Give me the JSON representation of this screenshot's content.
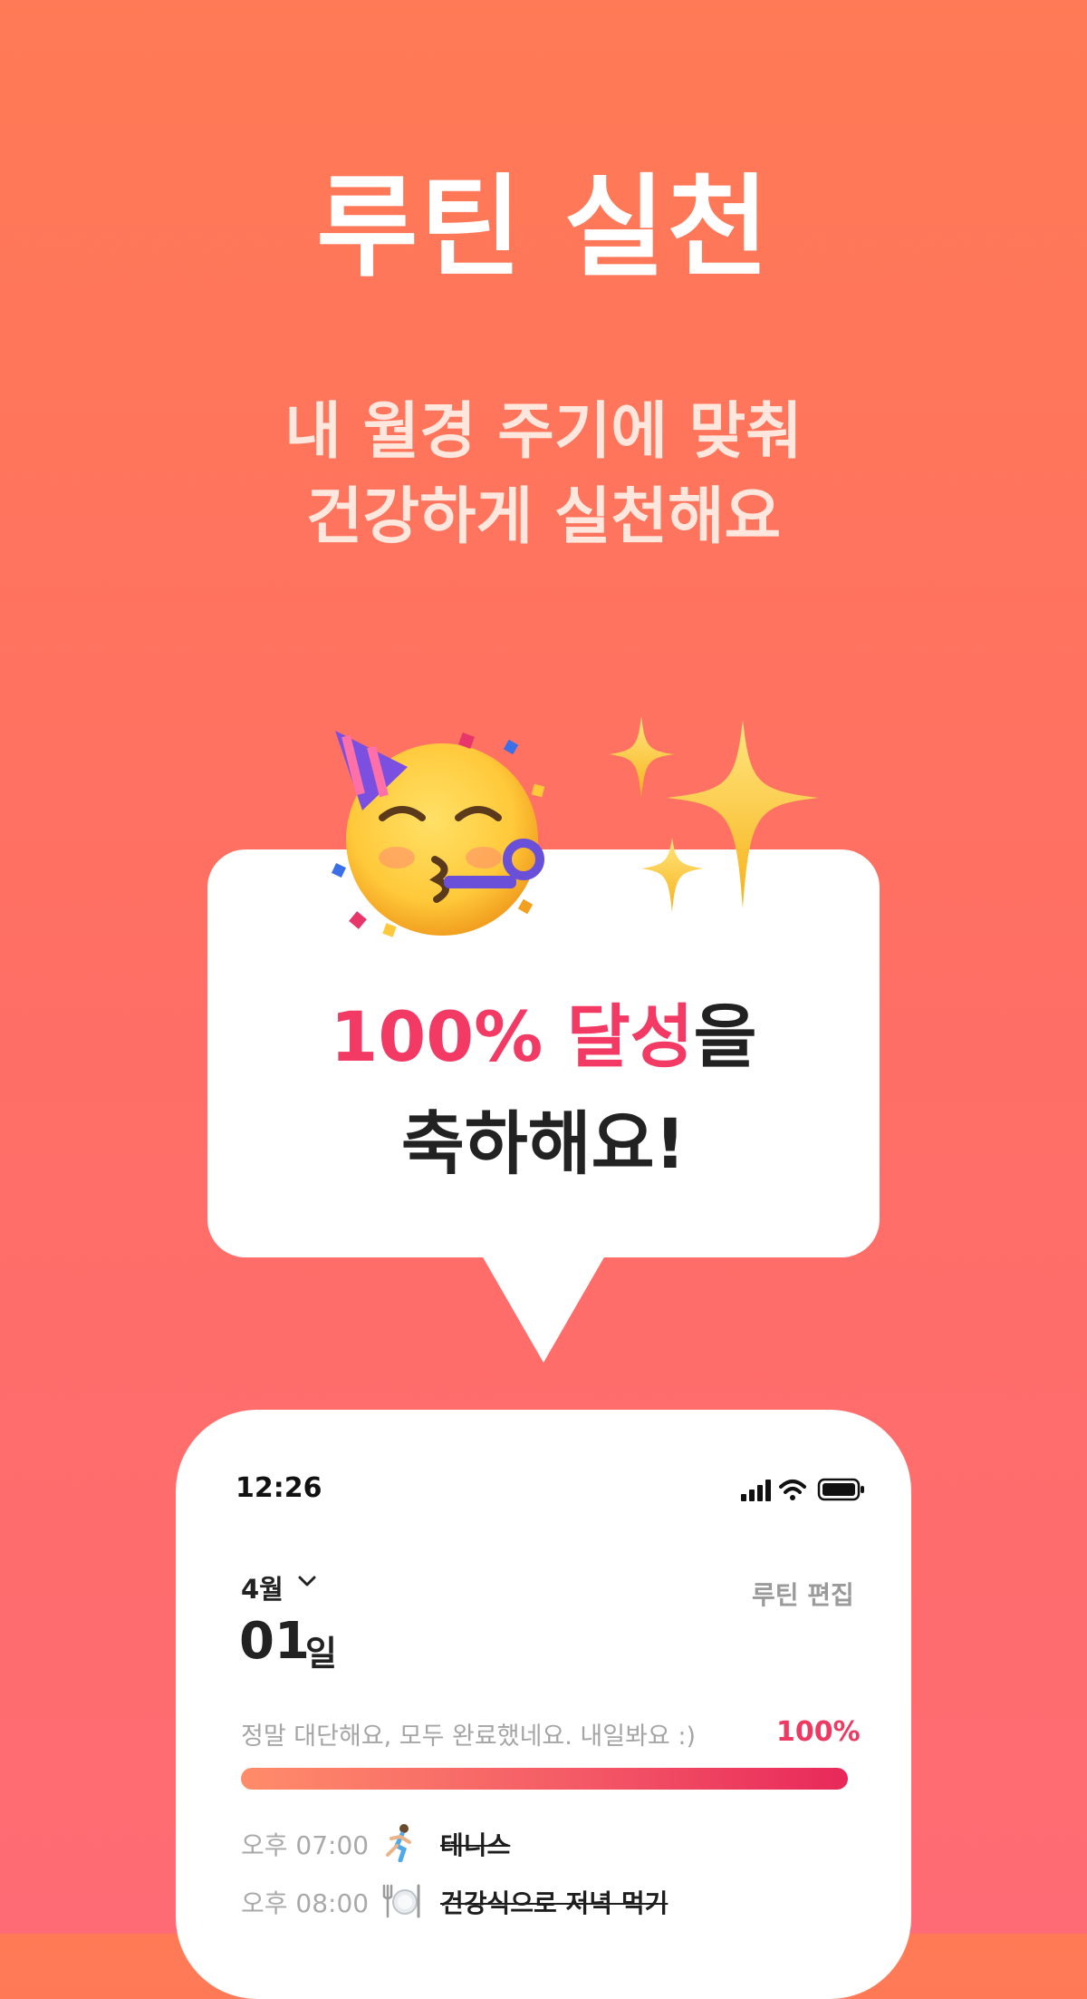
{
  "hero": {
    "title": "루틴 실천",
    "subtitle_line1": "내 월경 주기에 맞춰",
    "subtitle_line2": "건강하게 실천해요"
  },
  "celebration": {
    "highlight": "100% 달성",
    "suffix": "을",
    "line2": "축하해요!",
    "highlight_color": "#F23A64",
    "icons": [
      "partying-face-icon",
      "sparkles-icon"
    ]
  },
  "phone": {
    "status": {
      "time": "12:26",
      "icons": [
        "signal-icon",
        "wifi-icon",
        "battery-icon"
      ]
    },
    "header": {
      "month": "4월",
      "day": "01",
      "day_unit": "일",
      "edit_label": "루틴 편집"
    },
    "progress": {
      "message": "정말 대단해요, 모두 완료했네요. 내일봐요 :)",
      "percent_label": "100%",
      "value": 1.0
    },
    "routines": [
      {
        "time": "오후  07:00",
        "icon": "runner-icon",
        "name": "테니스",
        "done": true
      },
      {
        "time": "오후  08:00",
        "icon": "plate-icon",
        "name": "건강식으로 저녁 먹기",
        "done": true
      }
    ]
  },
  "colors": {
    "background_top": "#FF7A55",
    "background_bottom": "#FF6B74",
    "accent": "#EE3A62"
  }
}
